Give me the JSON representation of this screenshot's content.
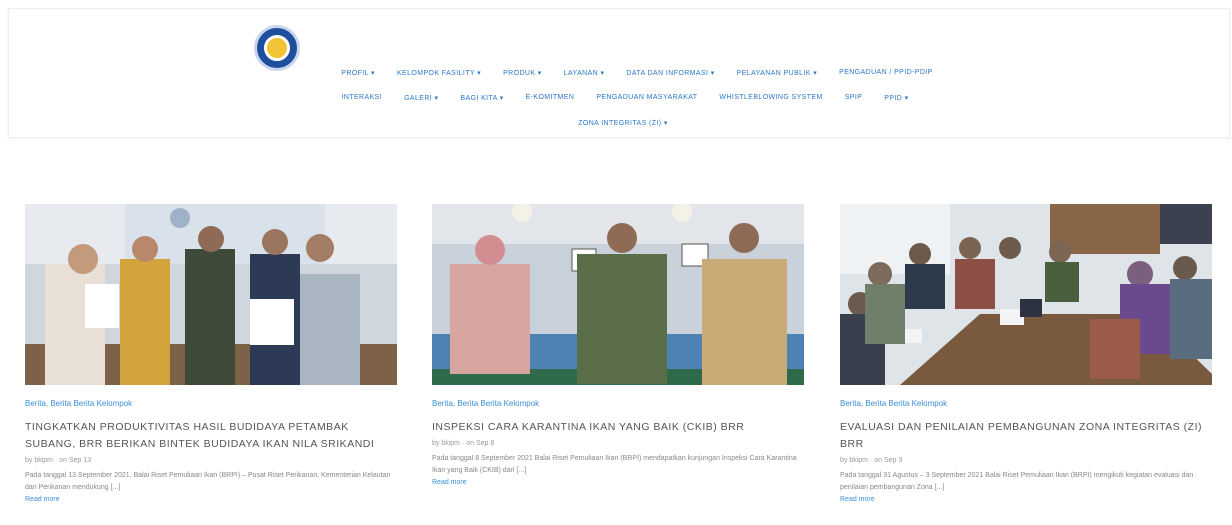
{
  "header": {
    "logo": "bkipm-logo",
    "nav_row1": [
      "PROFIL ▾",
      "KELOMPOK FASILITY ▾",
      "PRODUK ▾",
      "LAYANAN ▾",
      "DATA DAN INFORMASI ▾",
      "PELAYANAN PUBLIK ▾",
      "PENGADUAN / PPID-PDIP"
    ],
    "nav_row2": [
      "INTERAKSI",
      "GALERI ▾",
      "BAGI KITA ▾",
      "E-KOMITMEN",
      "PENGADUAN MASYARAKAT",
      "WHISTLEBLOWING SYSTEM",
      "SPIP",
      "PPID ▾"
    ],
    "nav_row3": [
      "ZONA INTEGRITAS (ZI) ▾"
    ]
  },
  "posts": [
    {
      "category": "Berita, Berita Berita Kelompok",
      "title": "TINGKATKAN PRODUKTIVITAS HASIL BUDIDAYA PETAMBAK SUBANG, BRR BERIKAN BINTEK BUDIDAYA IKAN NILA SRIKANDI",
      "meta": "by bkipm · on Sep 13",
      "excerpt": "Pada tanggal 13 September 2021, Balai Riset Pemuliaan Ikan (BRPI) – Pusat Riset Perikanan, Kementerian Kelautan dan Perikanan mendukung [...]",
      "read_more": "Read more"
    },
    {
      "category": "Berita, Berita Berita Kelompok",
      "title": "INSPEKSI CARA KARANTINA IKAN YANG BAIK (CKIB) BRR",
      "meta": "by bkipm · on Sep 8",
      "excerpt": "Pada tanggal 8 September 2021 Balai Riset Pemuliaan Ikan (BRPI) mendapatkan kunjungan Inspeksi Cara Karantina Ikan yang Baik (CKIB) dari [...]",
      "read_more": "Read more"
    },
    {
      "category": "Berita, Berita Berita Kelompok",
      "title": "EVALUASI DAN PENILAIAN PEMBANGUNAN ZONA INTEGRITAS (ZI) BRR",
      "meta": "by bkipm · on Sep 3",
      "excerpt": "Pada tanggal 31 Agustus – 3 September 2021 Balai Riset Pemuliaan Ikan (BRPI) mengikuti kegiatan evaluasi dan penilaian pembangunan Zona [...]",
      "read_more": "Read more"
    }
  ],
  "colors": {
    "link": "#2a78c9",
    "category": "#3a8fd6"
  }
}
